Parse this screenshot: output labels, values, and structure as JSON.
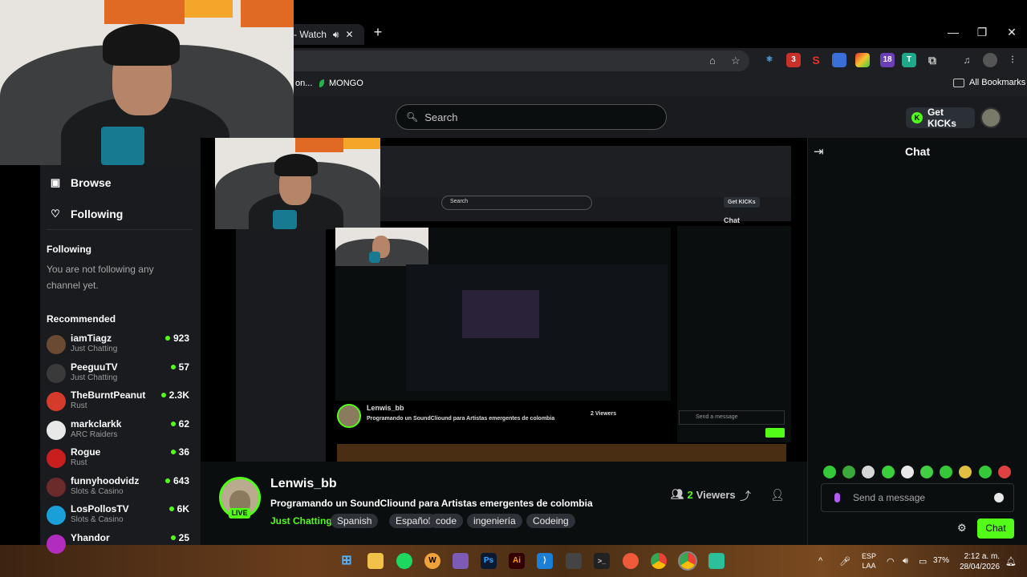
{
  "browser": {
    "tab_title": "- Watch",
    "bookmarks": [
      "on...",
      "MONGO"
    ],
    "all_bookmarks": "All Bookmarks",
    "ext_badges": [
      "3",
      "18"
    ]
  },
  "header": {
    "search_placeholder": "Search",
    "get_kicks": "Get KICKs"
  },
  "sidebar": {
    "browse": "Browse",
    "following": "Following",
    "following_heading": "Following",
    "following_empty": "You are not following any channel yet.",
    "recommended_heading": "Recommended",
    "recommended": [
      {
        "name": "iamTiagz",
        "category": "Just Chatting",
        "viewers": "923",
        "color": "#6b4a34"
      },
      {
        "name": "PeeguuTV",
        "category": "Just Chatting",
        "viewers": "57",
        "color": "#3a3a3a"
      },
      {
        "name": "TheBurntPeanut",
        "category": "Rust",
        "viewers": "2.3K",
        "color": "#d43b2a"
      },
      {
        "name": "markclarkk",
        "category": "ARC Raiders",
        "viewers": "62",
        "color": "#e8e8e8"
      },
      {
        "name": "Rogue",
        "category": "Rust",
        "viewers": "36",
        "color": "#c81e1e"
      },
      {
        "name": "funnyhoodvidz",
        "category": "Slots & Casino",
        "viewers": "643",
        "color": "#6b2b2b"
      },
      {
        "name": "LosPollosTV",
        "category": "Slots & Casino",
        "viewers": "6K",
        "color": "#1a9fd8"
      },
      {
        "name": "Yhandor",
        "category": "",
        "viewers": "25",
        "color": "#b22dbf"
      }
    ]
  },
  "stream": {
    "channel": "Lenwis_bb",
    "live": "LIVE",
    "title": "Programando un SoundCliound para Artistas emergentes de colombia",
    "category": "Just Chatting",
    "tags": [
      "Spanish",
      "Español",
      "code",
      "ingeniería",
      "Codeing"
    ],
    "viewers": "2",
    "viewers_label": "Viewers"
  },
  "chat": {
    "title": "Chat",
    "placeholder": "Send a message",
    "send": "Chat",
    "emote_colors": [
      "#35c93a",
      "#3aa83a",
      "#d6d6d6",
      "#3ccf3c",
      "#e8e8e8",
      "#42d042",
      "#35c93a",
      "#e0c040",
      "#35c93a",
      "#e04040"
    ]
  },
  "taskbar": {
    "lang": "ESP",
    "layout": "LAA",
    "battery": "37%",
    "time": "2:12 a. m.",
    "date": "28/04/2026"
  },
  "mirror": {
    "search": "Search",
    "get_kicks": "Get KICKs",
    "chat": "Chat",
    "channel": "Lenwis_bb",
    "title": "Programando un SoundCliound para Artistas emergentes de colombia",
    "viewers": "2 Viewers",
    "send": "Send a message"
  }
}
